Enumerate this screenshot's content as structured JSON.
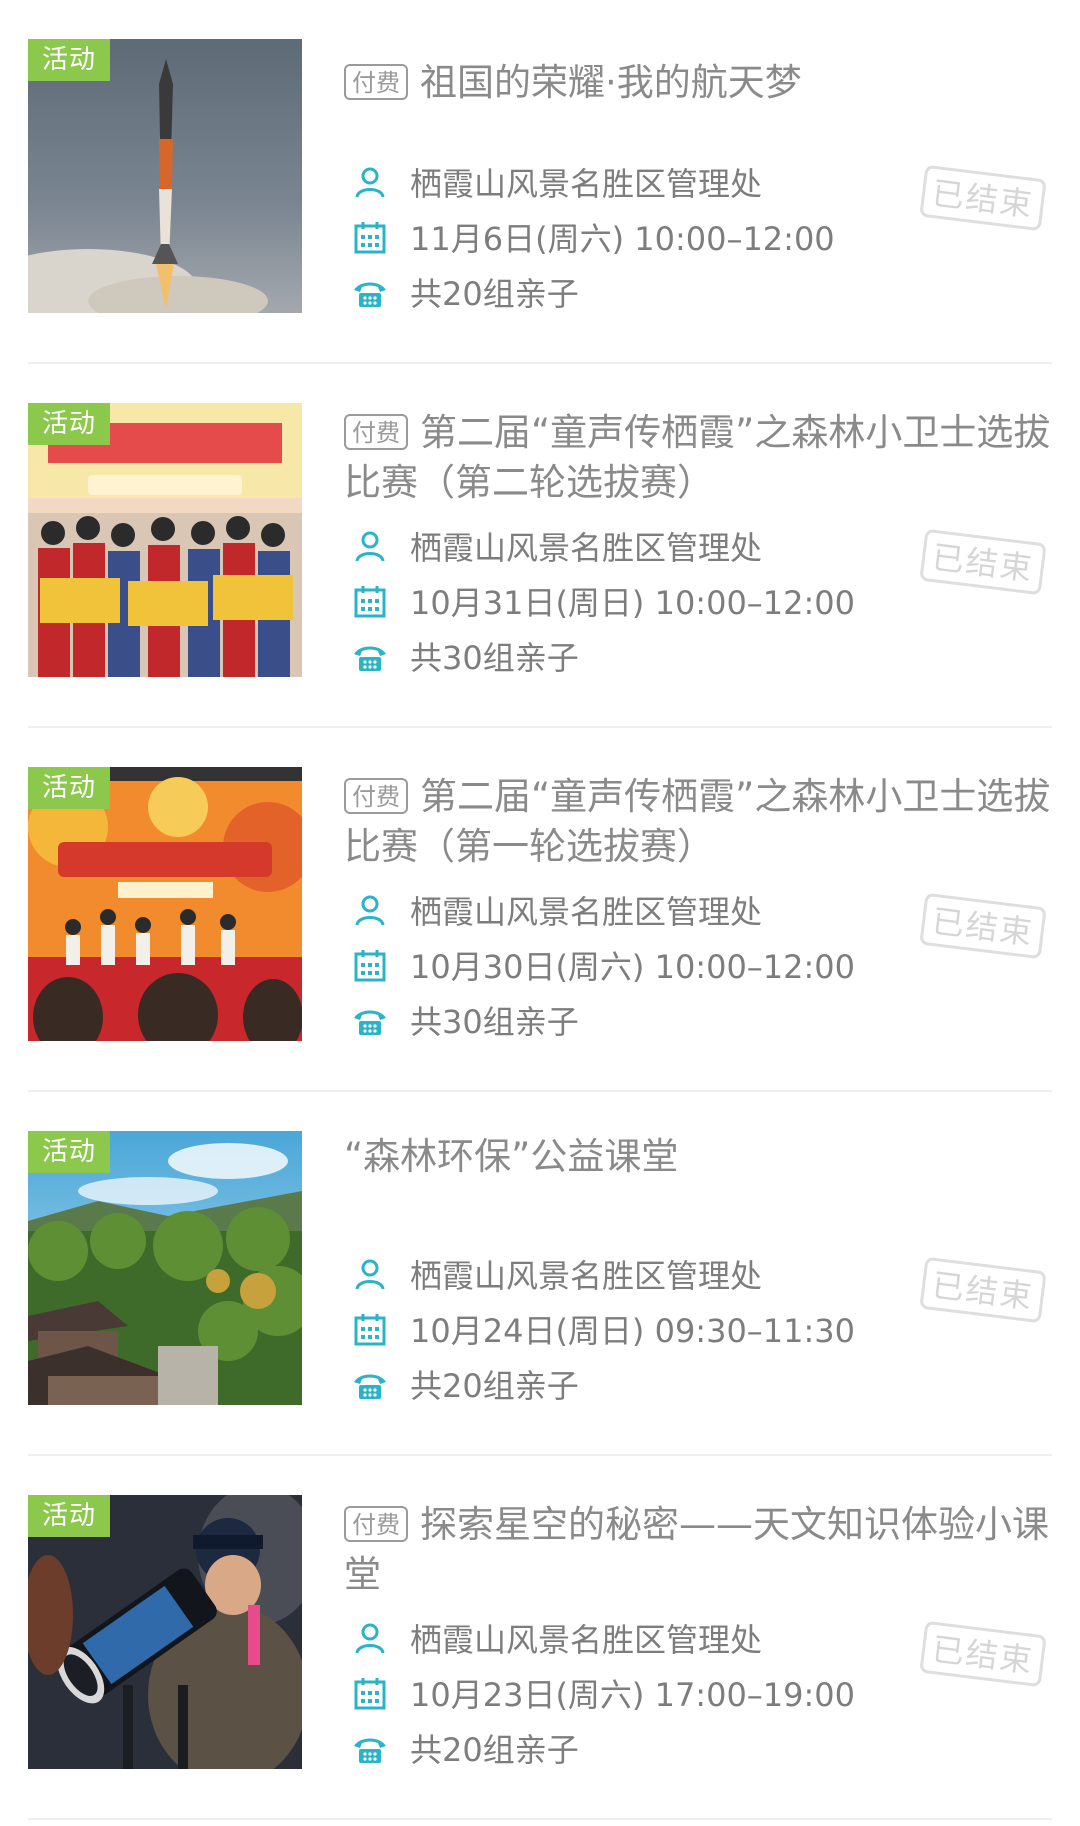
{
  "activities": [
    {
      "badge": "活动",
      "paid_tag": "付费",
      "title": "祖国的荣耀·我的航天梦",
      "organizer": "栖霞山风景名胜区管理处",
      "datetime": "11月6日(周六) 10:00–12:00",
      "capacity": "共20组亲子",
      "status": "已结束",
      "image": "rocket-launch"
    },
    {
      "badge": "活动",
      "paid_tag": "付费",
      "title": "第二届“童声传栖霞”之森林小卫士选拔比赛（第二轮选拔赛）",
      "organizer": "栖霞山风景名胜区管理处",
      "datetime": "10月31日(周日) 10:00–12:00",
      "capacity": "共30组亲子",
      "status": "已结束",
      "image": "children-holding-cards"
    },
    {
      "badge": "活动",
      "paid_tag": "付费",
      "title": "第二届“童声传栖霞”之森林小卫士选拔比赛（第一轮选拔赛）",
      "organizer": "栖霞山风景名胜区管理处",
      "datetime": "10月30日(周六) 10:00–12:00",
      "capacity": "共30组亲子",
      "status": "已结束",
      "image": "stage-performance"
    },
    {
      "badge": "活动",
      "paid_tag": "",
      "title": "“森林环保”公益课堂",
      "organizer": "栖霞山风景名胜区管理处",
      "datetime": "10月24日(周日) 09:30–11:30",
      "capacity": "共20组亲子",
      "status": "已结束",
      "image": "forest-temple"
    },
    {
      "badge": "活动",
      "paid_tag": "付费",
      "title": "探索星空的秘密——天文知识体验小课堂",
      "organizer": "栖霞山风景名胜区管理处",
      "datetime": "10月23日(周六) 17:00–19:00",
      "capacity": "共20组亲子",
      "status": "已结束",
      "image": "telescope"
    }
  ],
  "icons": {
    "organizer": "person-icon",
    "datetime": "calendar-icon",
    "capacity": "phone-icon"
  },
  "colors": {
    "badge": "#8cc84b",
    "icon": "#2bb3c8",
    "text": "#7d7d7d"
  }
}
